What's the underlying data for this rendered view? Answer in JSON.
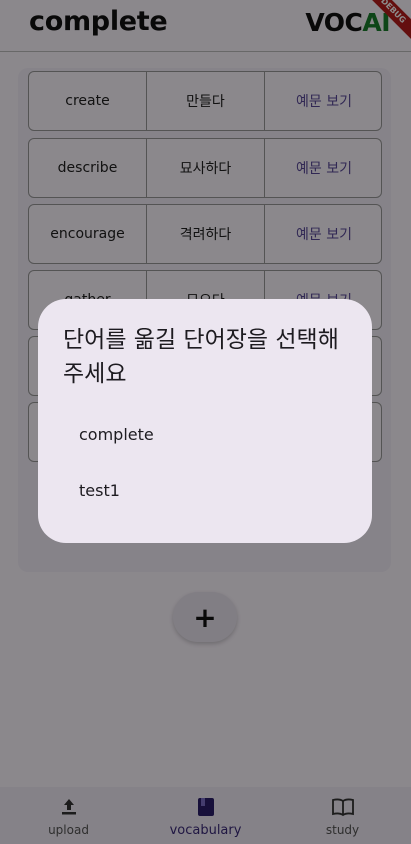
{
  "header": {
    "title": "complete",
    "logo_voc": "VOC",
    "logo_ai": "AI",
    "debug_label": "DEBUG"
  },
  "words": [
    {
      "en": "create",
      "ko": "만들다",
      "action": "예문 보기"
    },
    {
      "en": "describe",
      "ko": "묘사하다",
      "action": "예문 보기"
    },
    {
      "en": "encourage",
      "ko": "격려하다",
      "action": "예문 보기"
    },
    {
      "en": "gather",
      "ko": "모으다",
      "action": "예문 보기"
    },
    {
      "en": "",
      "ko": "",
      "action": ""
    },
    {
      "en": "",
      "ko": "",
      "action": ""
    }
  ],
  "fab": {
    "label": "+"
  },
  "bottom_nav": [
    {
      "label": "upload",
      "icon": "upload-icon"
    },
    {
      "label": "vocabulary",
      "icon": "book-icon"
    },
    {
      "label": "study",
      "icon": "open-book-icon"
    }
  ],
  "dialog": {
    "title": "단어를 옮길 단어장을 선택해 주세요",
    "options": [
      "complete",
      "test1"
    ]
  }
}
